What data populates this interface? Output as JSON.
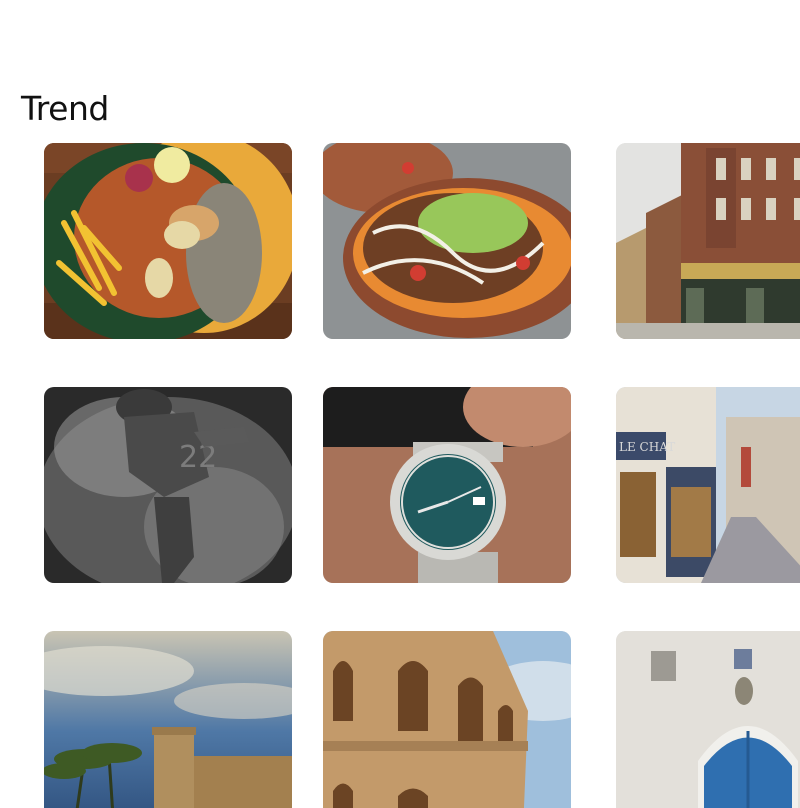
{
  "trend": {
    "title": "Trend",
    "images": [
      {
        "subject": "grilled fish platter with fries and rice",
        "icon": "food-plate-image"
      },
      {
        "subject": "loaded sweet potato with guacamole",
        "icon": "sweet-potato-image"
      },
      {
        "subject": "brick pub on a street corner",
        "icon": "pub-street-image"
      },
      {
        "subject": "american football player in smoke, black and white",
        "icon": "football-player-image"
      },
      {
        "subject": "wristwatch with green dial",
        "icon": "wristwatch-image"
      },
      {
        "subject": "paris street with cafe shopfront",
        "icon": "paris-street-image"
      },
      {
        "subject": "stone fortress with palm trees under cloudy sky",
        "icon": "fortress-image"
      },
      {
        "subject": "ancient roman amphitheatre arches",
        "icon": "amphitheatre-image"
      },
      {
        "subject": "white wall with blue arched door",
        "icon": "blue-door-image"
      }
    ]
  }
}
